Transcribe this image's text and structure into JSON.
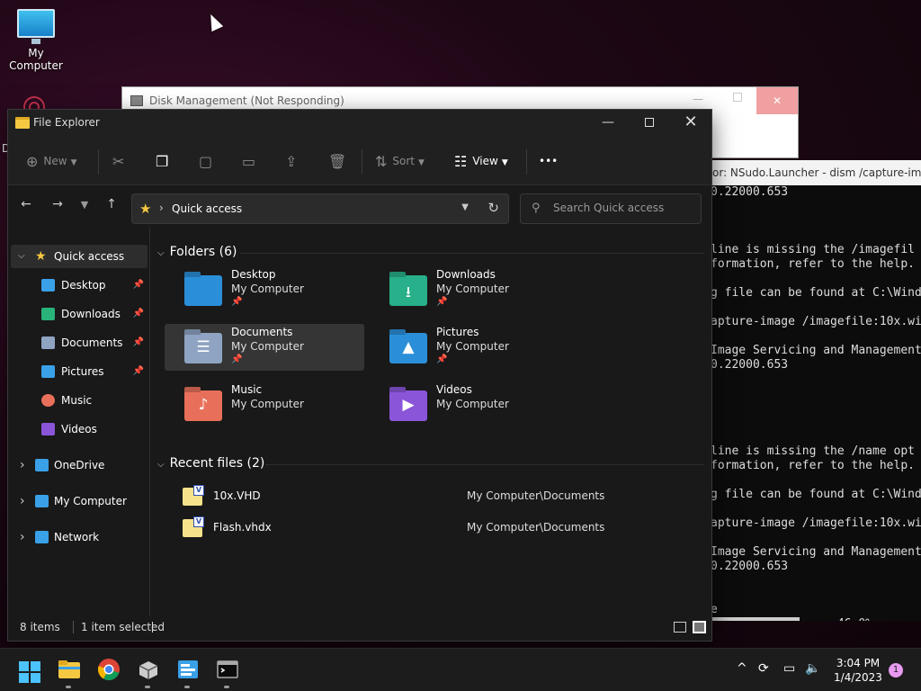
{
  "desktop": {
    "icon_label": "My Computer",
    "partial_label": "D"
  },
  "disk_management": {
    "title": "Disk Management (Not Responding)",
    "close_glyph": "✕",
    "min_glyph": "—"
  },
  "terminal": {
    "title": "or: NSudo.Launcher - dism  /capture-image",
    "lines": [
      "0.22000.653",
      "",
      "",
      "",
      "line is missing the /imagefil",
      "formation, refer to the help.",
      "",
      "g file can be found at C:\\Wind",
      "",
      "apture-image /imagefile:10x.wi",
      "",
      "Image Servicing and Management",
      "0.22000.653",
      "",
      "",
      "",
      "",
      "",
      "line is missing the /name opt",
      "formation, refer to the help.",
      "",
      "g file can be found at C:\\Wind",
      "",
      "apture-image /imagefile:10x.wi",
      "",
      "Image Servicing and Management",
      "0.22000.653",
      "",
      "",
      "e",
      "================= 46.0%"
    ]
  },
  "explorer": {
    "title": "File Explorer",
    "window_controls": {
      "minimize": "—",
      "close": "✕"
    },
    "toolbar": {
      "new_label": "New",
      "sort_label": "Sort",
      "view_label": "View",
      "more_label": "•••"
    },
    "address": {
      "location": "Quick access"
    },
    "search": {
      "placeholder": "Search Quick access"
    },
    "sidebar": {
      "items": [
        {
          "label": "Quick access",
          "icon": "star-icon",
          "color": "#f5c842"
        },
        {
          "label": "Desktop",
          "icon": "desktop-folder-icon",
          "color": "#3aa0e8",
          "pinned": true
        },
        {
          "label": "Downloads",
          "icon": "download-icon",
          "color": "#2ab27b",
          "pinned": true
        },
        {
          "label": "Documents",
          "icon": "documents-icon",
          "color": "#8fa4c2",
          "pinned": true
        },
        {
          "label": "Pictures",
          "icon": "pictures-icon",
          "color": "#3aa0e8",
          "pinned": true
        },
        {
          "label": "Music",
          "icon": "music-icon",
          "color": "#e8705a"
        },
        {
          "label": "Videos",
          "icon": "videos-icon",
          "color": "#8a55d8"
        },
        {
          "label": "OneDrive",
          "icon": "cloud-icon",
          "color": "#3aa0e8"
        },
        {
          "label": "My Computer",
          "icon": "computer-icon",
          "color": "#3aa0e8"
        },
        {
          "label": "Network",
          "icon": "network-icon",
          "color": "#3aa0e8"
        }
      ]
    },
    "folders": {
      "header": "Folders (6)",
      "items": [
        {
          "name": "Desktop",
          "location": "My Computer",
          "pin": "📌",
          "color": "#2a8fd8",
          "glyph": ""
        },
        {
          "name": "Downloads",
          "location": "My Computer",
          "pin": "📌",
          "color": "#27b08a",
          "glyph": "⭳"
        },
        {
          "name": "Documents",
          "location": "My Computer",
          "pin": "📌",
          "color": "#8fa4c2",
          "glyph": "☰"
        },
        {
          "name": "Pictures",
          "location": "My Computer",
          "pin": "📌",
          "color": "#2a8fd8",
          "glyph": "▲"
        },
        {
          "name": "Music",
          "location": "My Computer",
          "pin": "",
          "color": "#e8705a",
          "glyph": "♪"
        },
        {
          "name": "Videos",
          "location": "My Computer",
          "pin": "",
          "color": "#8a55d8",
          "glyph": "▶"
        }
      ]
    },
    "recent": {
      "header": "Recent files (2)",
      "items": [
        {
          "name": "10x.VHD",
          "location": "My Computer\\Documents",
          "badge": "V"
        },
        {
          "name": "Flash.vhdx",
          "location": "My Computer\\Documents",
          "badge": "V"
        }
      ]
    },
    "status": {
      "items_count": "8 items",
      "selected": "1 item selected"
    }
  },
  "taskbar": {
    "time": "3:04 PM",
    "date": "1/4/2023",
    "notification_count": "1"
  }
}
